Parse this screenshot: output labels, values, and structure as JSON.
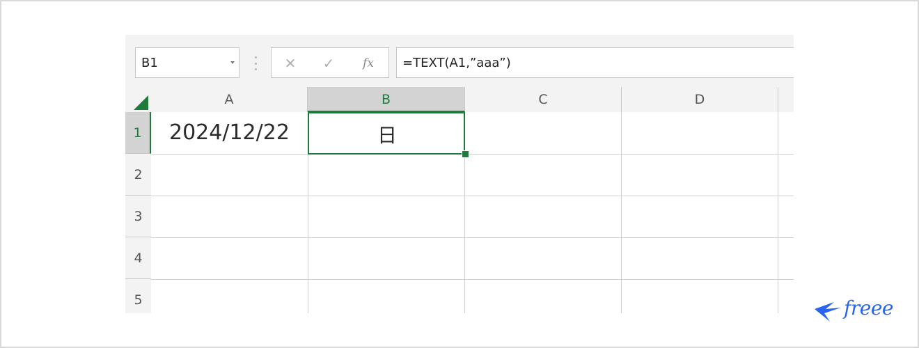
{
  "name_box": {
    "value": "B1"
  },
  "formula_bar": {
    "cancel_glyph": "✕",
    "enter_glyph": "✓",
    "fx_label": "fx",
    "value": "=TEXT(A1,”aaa”)"
  },
  "columns": [
    "A",
    "B",
    "C",
    "D"
  ],
  "active_column": "B",
  "rows": [
    "1",
    "2",
    "3",
    "4",
    "5"
  ],
  "active_row": "1",
  "cells": {
    "A1": "2024/12/22",
    "B1": "日"
  },
  "selected_cell": "B1",
  "logo": {
    "text": "freee"
  },
  "colors": {
    "selection": "#1e7b3a",
    "logo": "#2864f0",
    "header_bg": "#f3f3f3",
    "active_header_bg": "#d3d3d3"
  },
  "icons": [
    "dropdown-caret-icon",
    "grip-icon",
    "cancel-icon",
    "enter-check-icon",
    "fx-icon",
    "select-all-triangle-icon",
    "freee-bird-icon"
  ]
}
